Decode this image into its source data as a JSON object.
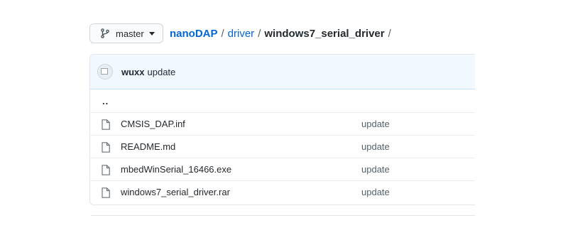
{
  "branch": {
    "label": "master",
    "icon": "git-branch-icon",
    "caret": "caret-down-icon"
  },
  "breadcrumb": {
    "root": "nanoDAP",
    "path": [
      "driver"
    ],
    "current": "windows7_serial_driver",
    "separator": "/"
  },
  "commit": {
    "author": "wuxx",
    "message": "update"
  },
  "parent_link": "..",
  "files": [
    {
      "name": "CMSIS_DAP.inf",
      "commit": "update",
      "icon": "file-icon"
    },
    {
      "name": "README.md",
      "commit": "update",
      "icon": "file-icon"
    },
    {
      "name": "mbedWinSerial_16466.exe",
      "commit": "update",
      "icon": "file-icon"
    },
    {
      "name": "windows7_serial_driver.rar",
      "commit": "update",
      "icon": "file-icon"
    }
  ],
  "colors": {
    "link": "#0366d6",
    "header_bg": "#f1f8ff",
    "border": "#e1e4e8",
    "muted": "#586069"
  }
}
